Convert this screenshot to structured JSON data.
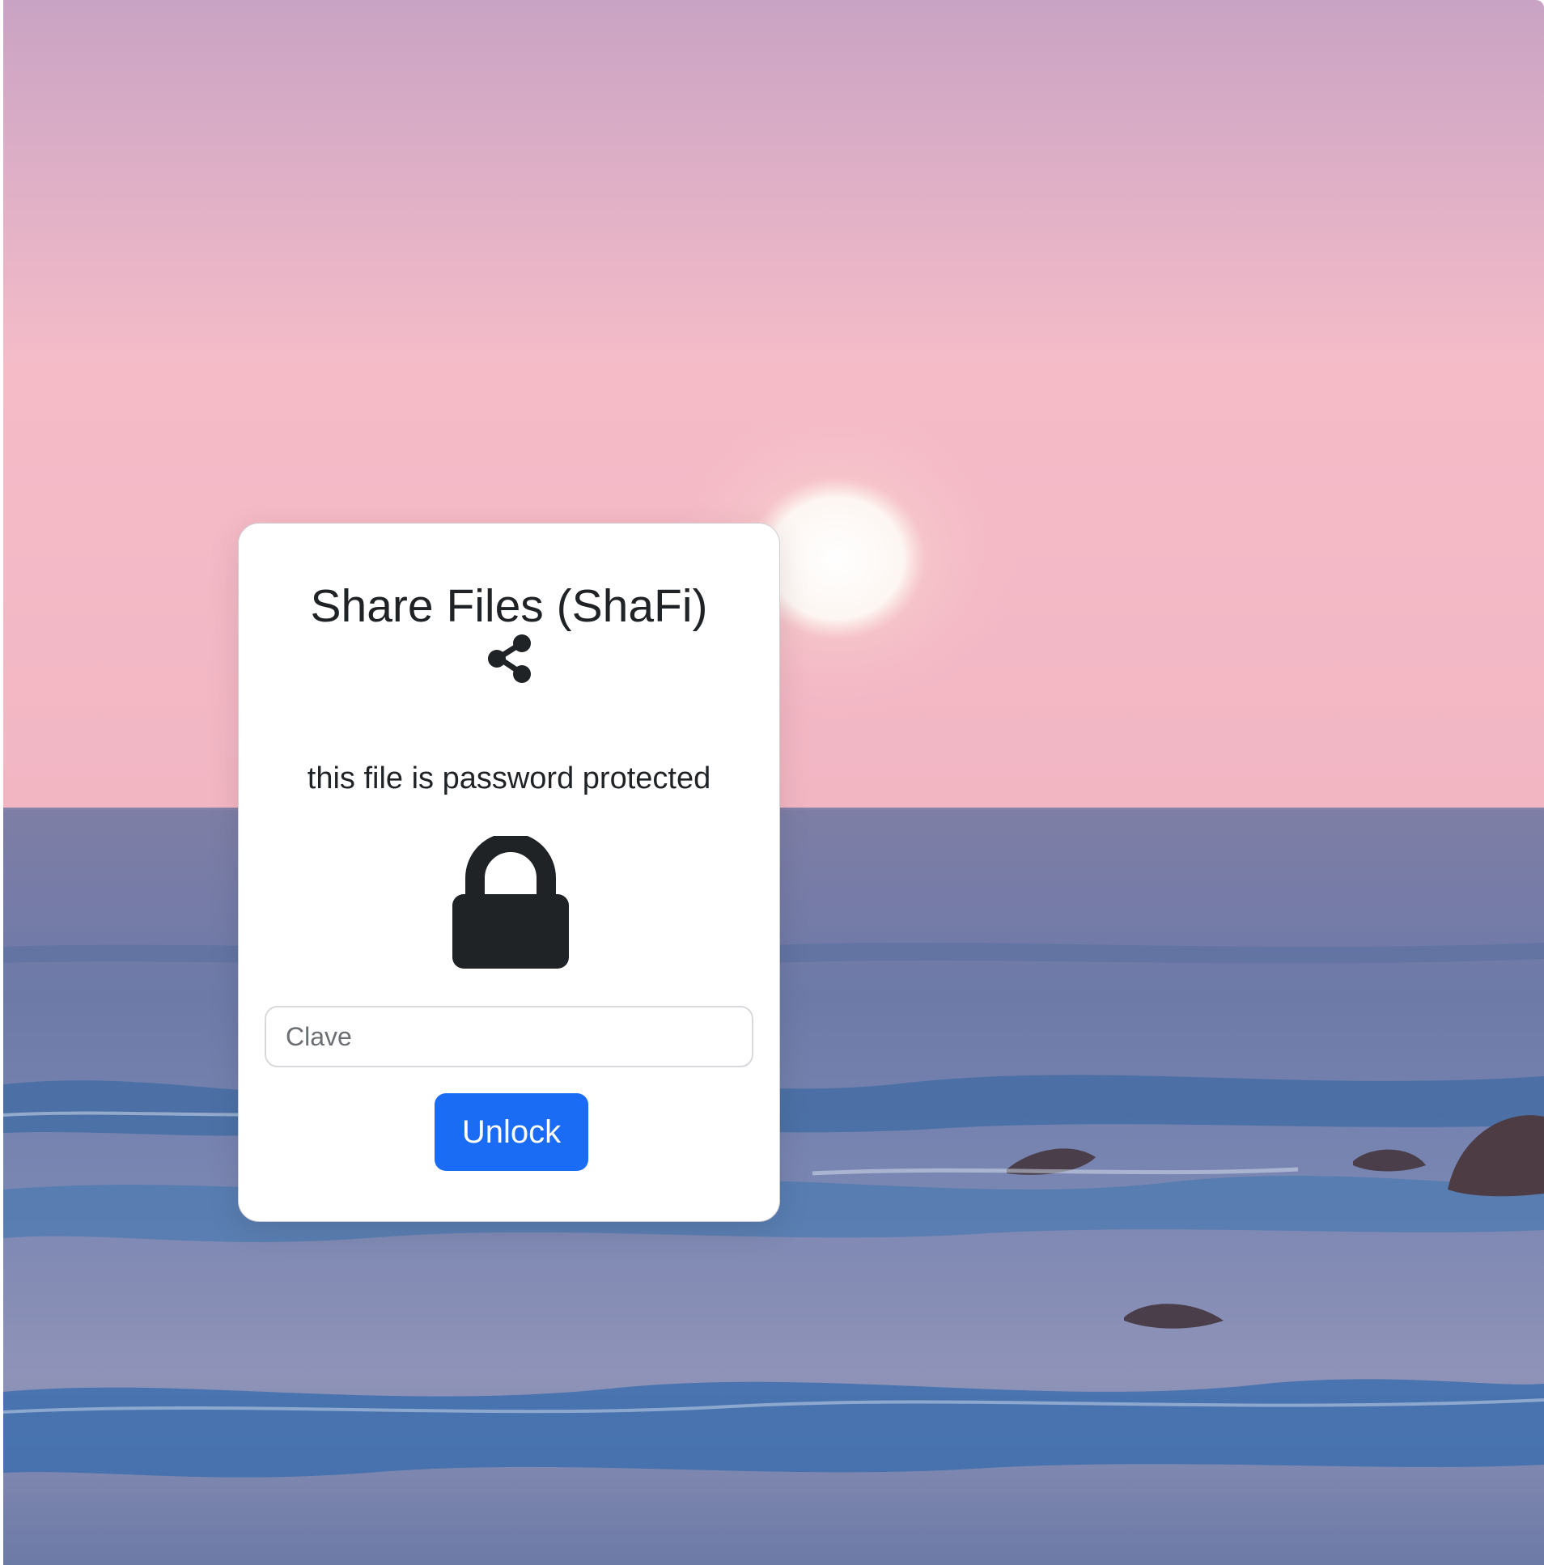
{
  "app": {
    "title": "Share Files (ShaFi)"
  },
  "card": {
    "message": "this file is password protected",
    "share_icon": "share-icon",
    "lock_icon": "lock-icon"
  },
  "password_input": {
    "placeholder": "Clave",
    "value": ""
  },
  "unlock_button": {
    "label": "Unlock",
    "color": "#1a6cf5"
  },
  "background": {
    "description_icon": "sunset-sea-background",
    "sky_colors": [
      "#c9a3c4",
      "#f6bcc7",
      "#f1b5c2"
    ],
    "sea_colors": [
      "#8c8fb3",
      "#4b6fa4",
      "#8b92b8"
    ]
  }
}
